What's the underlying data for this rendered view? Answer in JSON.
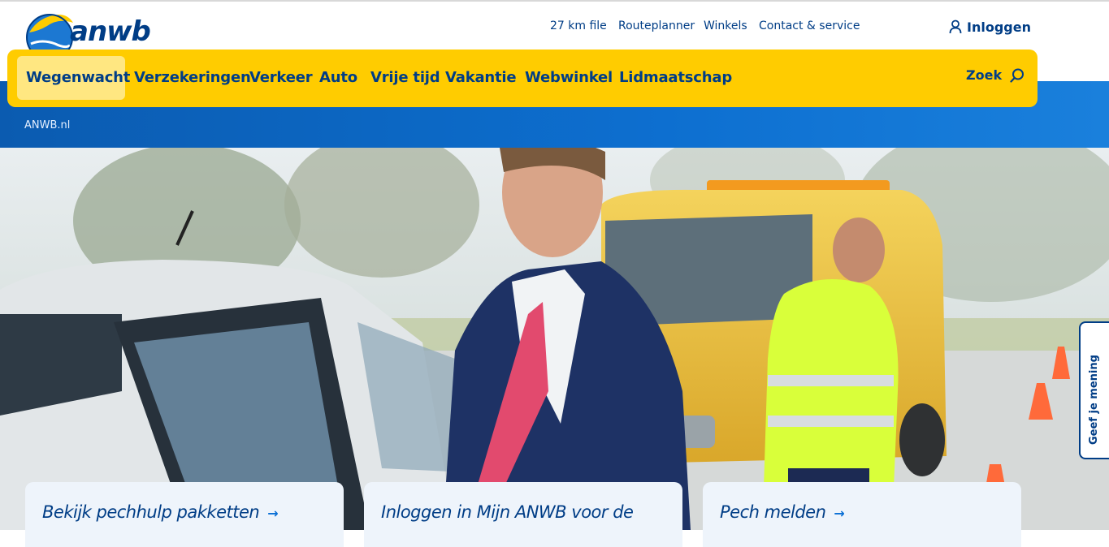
{
  "logo": {
    "text": "anwb"
  },
  "utility_nav": {
    "traffic": "27 km file",
    "routeplanner": "Routeplanner",
    "winkels": "Winkels",
    "contact": "Contact & service",
    "login": "Inloggen"
  },
  "main_nav": {
    "items": [
      {
        "label": "Wegenwacht",
        "active": true
      },
      {
        "label": "Verzekeringen",
        "active": false
      },
      {
        "label": "Verkeer",
        "active": false
      },
      {
        "label": "Auto",
        "active": false
      },
      {
        "label": "Vrije tijd",
        "active": false
      },
      {
        "label": "Vakantie",
        "active": false
      },
      {
        "label": "Webwinkel",
        "active": false
      },
      {
        "label": "Lidmaatschap",
        "active": false
      }
    ],
    "search_label": "Zoek"
  },
  "breadcrumb": {
    "root": "ANWB.nl"
  },
  "feedback": {
    "label": "Geef je mening"
  },
  "cards": [
    {
      "title": "Bekijk pechhulp pakketten",
      "arrow": "→"
    },
    {
      "title": "Inloggen in Mijn ANWB voor de",
      "arrow": ""
    },
    {
      "title": "Pech melden",
      "arrow": "→"
    }
  ],
  "colors": {
    "brand_yellow": "#ffcc00",
    "brand_blue": "#003d86",
    "header_blue": "#0b5bb0",
    "card_bg": "#eef4fb"
  },
  "icons": {
    "login": "user-icon",
    "search": "search-icon",
    "card_link": "arrow-right-icon"
  }
}
